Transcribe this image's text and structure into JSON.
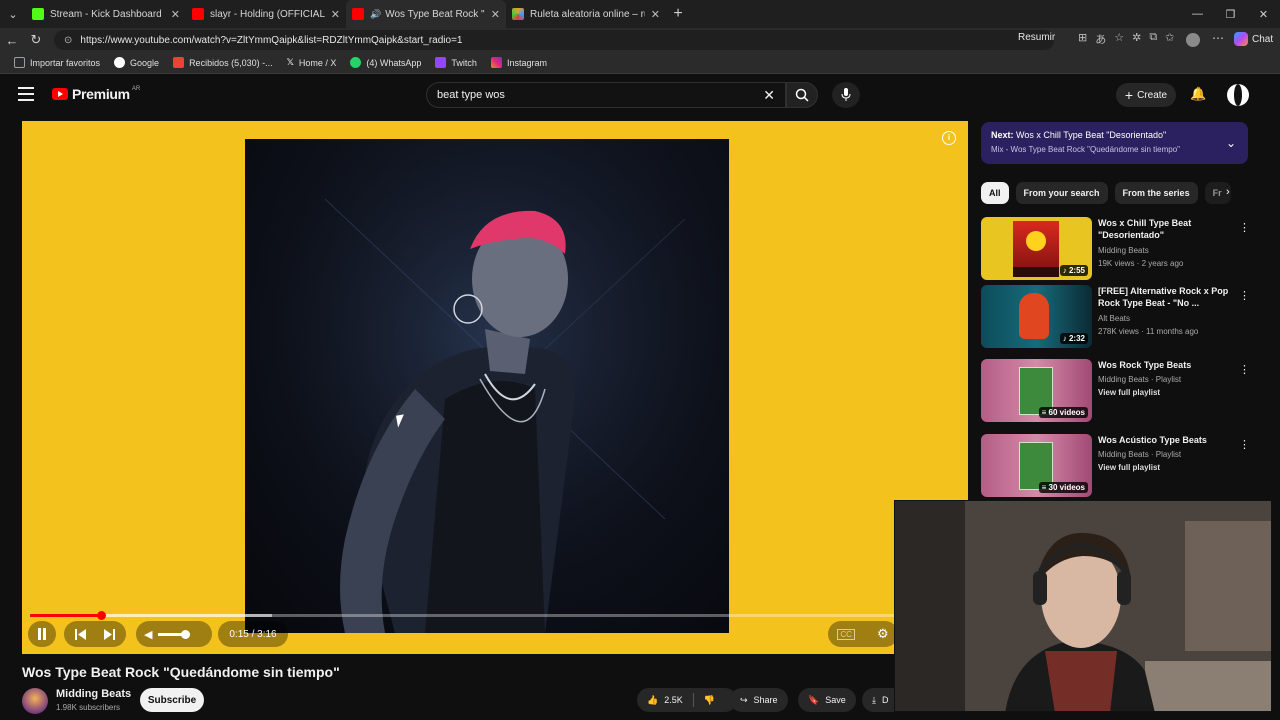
{
  "browser": {
    "tabs": [
      {
        "title": "Stream - Kick Dashboard",
        "color": "#53fc18"
      },
      {
        "title": "slayr - Holding (OFFICIAL MUSIC V",
        "color": "#ff0000"
      },
      {
        "title": "Wos Type Beat Rock \"Quedán",
        "color": "#ff0000",
        "active": true
      },
      {
        "title": "Ruleta aleatoria online – ruleta de",
        "color": "#e8a020"
      }
    ],
    "url": "https://www.youtube.com/watch?v=ZltYmmQaipk&list=RDZltYmmQaipk&start_radio=1",
    "resumir": "Resumir",
    "chat": "Chat",
    "bookmarks": [
      {
        "label": "Importar favoritos",
        "color": "#9aa0a6"
      },
      {
        "label": "Google",
        "color": "#4285f4"
      },
      {
        "label": "Recibidos (5,030) -...",
        "color": "#ea4335"
      },
      {
        "label": "Home / X",
        "color": "#ffffff"
      },
      {
        "label": "(4) WhatsApp",
        "color": "#25d366"
      },
      {
        "label": "Twitch",
        "color": "#9146ff"
      },
      {
        "label": "Instagram",
        "color": "#e1306c"
      }
    ]
  },
  "youtube": {
    "logo": "Premium",
    "logo_country": "AR",
    "search_query": "beat type wos",
    "create_label": "Create"
  },
  "player": {
    "background": "#f4c21c",
    "time": "0:15 / 3:16",
    "progress_fraction": 0.0765,
    "buffer_fraction": 0.26
  },
  "video": {
    "title": "Wos Type Beat Rock \"Quedándome sin tiempo\"",
    "channel": "Midding Beats",
    "subscribers": "1.98K subscribers",
    "subscribe_label": "Subscribe",
    "likes": "2.5K",
    "share_label": "Share",
    "save_label": "Save",
    "download_label": "D"
  },
  "sidebar": {
    "next_prefix": "Next:",
    "next_title": "Wos x Chill Type Beat \"Desorientado\"",
    "mix_title": "Mix - Wos Type Beat Rock \"Quedándome sin tiempo\"",
    "chips": [
      "All",
      "From your search",
      "From the series",
      "Fr"
    ],
    "recommendations": [
      {
        "title": "Wos x Chill Type Beat \"Desorientado\"",
        "channel": "Midding Beats",
        "meta": "19K views · 2 years ago",
        "badge": "2:55",
        "thumb": "sunset"
      },
      {
        "title": "[FREE] Alternative Rock x Pop Rock Type Beat - \"No ...",
        "channel": "Alt Beats",
        "meta": "278K views · 11 months ago",
        "badge": "2:32",
        "thumb": "redhair"
      },
      {
        "title": "Wos Rock Type Beats",
        "channel": "Midding Beats · Playlist",
        "meta": "View full playlist",
        "badge": "60 videos",
        "thumb": "playlist"
      },
      {
        "title": "Wos Acústico Type Beats",
        "channel": "Midding Beats · Playlist",
        "meta": "View full playlist",
        "badge": "30 videos",
        "thumb": "playlist"
      }
    ]
  }
}
